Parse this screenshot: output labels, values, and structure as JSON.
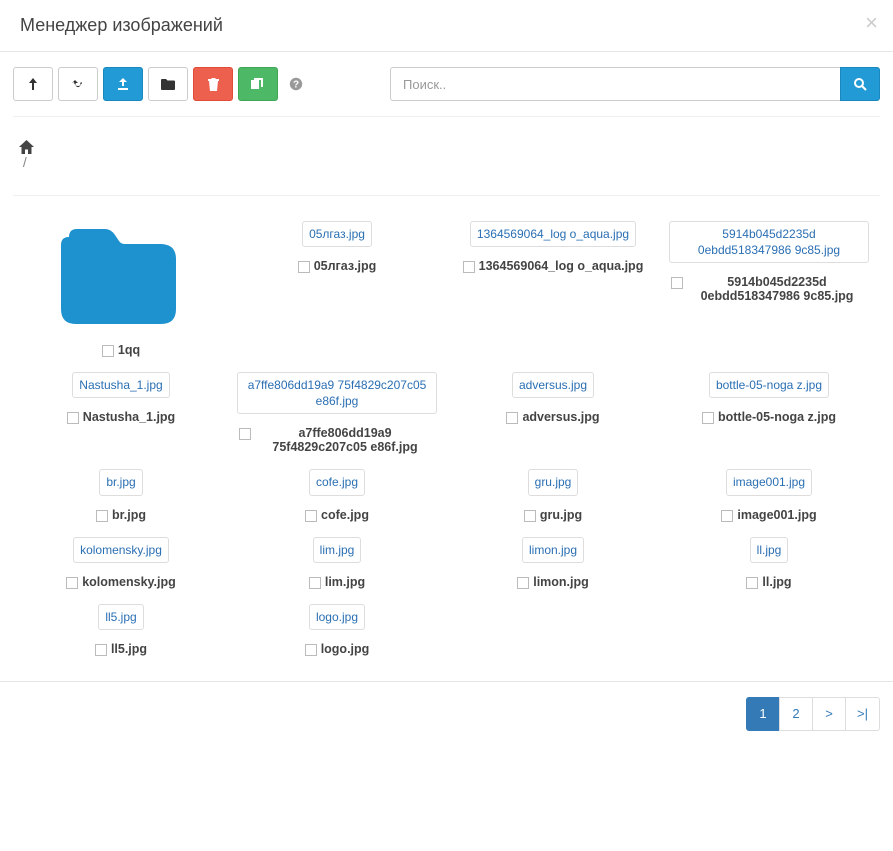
{
  "header": {
    "title": "Менеджер изображений"
  },
  "search": {
    "placeholder": "Поиск.."
  },
  "breadcrumb": {
    "sep": "/"
  },
  "items": [
    {
      "type": "folder",
      "name": "1qq"
    },
    {
      "type": "file",
      "name": "05лгаз.jpg"
    },
    {
      "type": "file",
      "name": "1364569064_log o_aqua.jpg"
    },
    {
      "type": "file",
      "name": "5914b045d2235d 0ebdd518347986 9c85.jpg"
    },
    {
      "type": "file",
      "name": "Nastusha_1.jpg"
    },
    {
      "type": "file",
      "name": "a7ffe806dd19a9 75f4829c207c05 e86f.jpg"
    },
    {
      "type": "file",
      "name": "adversus.jpg"
    },
    {
      "type": "file",
      "name": "bottle-05-noga z.jpg"
    },
    {
      "type": "file",
      "name": "br.jpg"
    },
    {
      "type": "file",
      "name": "cofe.jpg"
    },
    {
      "type": "file",
      "name": "gru.jpg"
    },
    {
      "type": "file",
      "name": "image001.jpg"
    },
    {
      "type": "file",
      "name": "kolomensky.jpg"
    },
    {
      "type": "file",
      "name": "lim.jpg"
    },
    {
      "type": "file",
      "name": "limon.jpg"
    },
    {
      "type": "file",
      "name": "ll.jpg"
    },
    {
      "type": "file",
      "name": "ll5.jpg"
    },
    {
      "type": "file",
      "name": "logo.jpg"
    }
  ],
  "pagination": {
    "pages": [
      "1",
      "2",
      ">",
      ">|"
    ],
    "active": 0
  }
}
